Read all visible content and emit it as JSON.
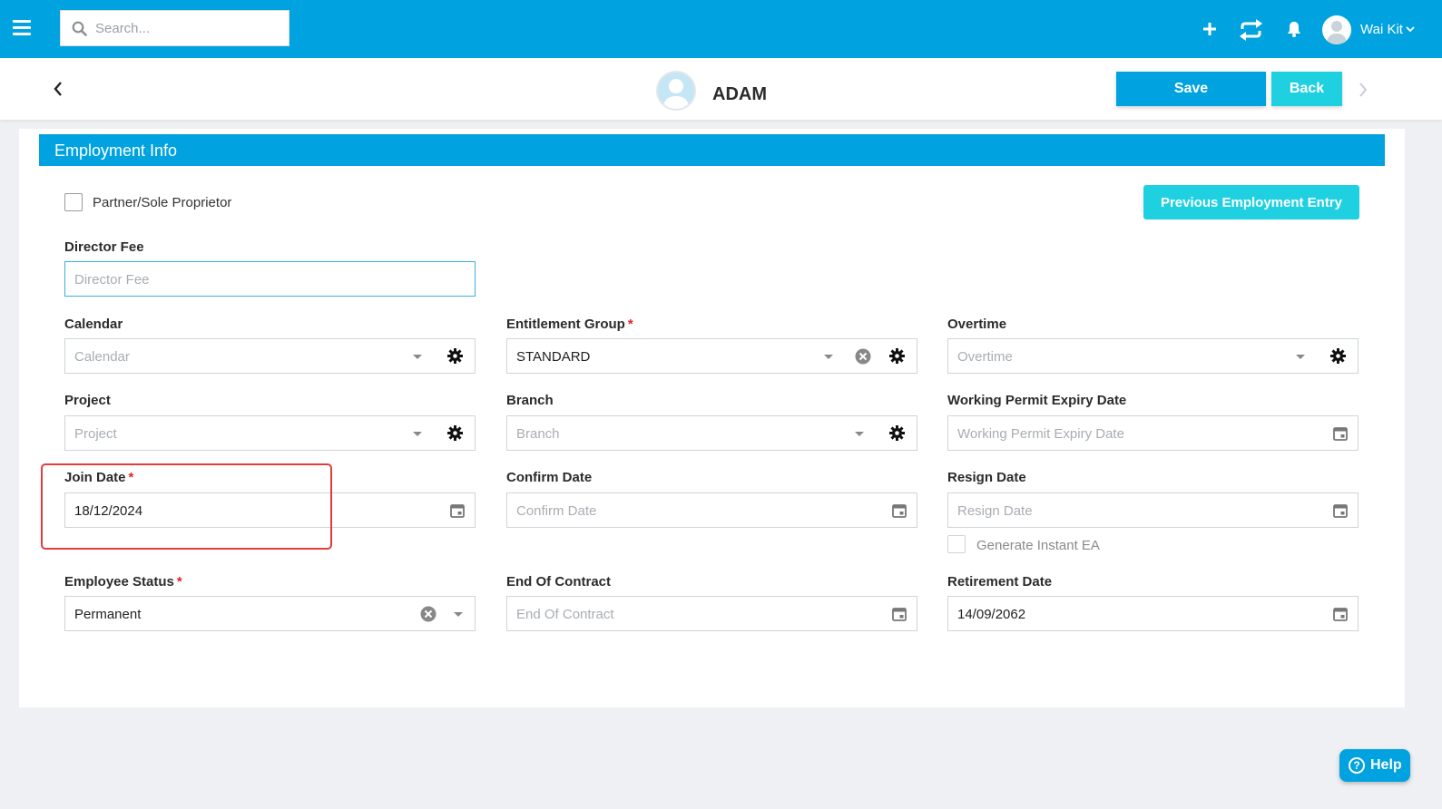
{
  "topbar": {
    "search_placeholder": "Search...",
    "icons": [
      "menu-icon",
      "search-icon",
      "plus-icon",
      "sync-icon",
      "bell-icon",
      "user-avatar",
      "chevron-down-icon"
    ],
    "user_name": "Wai Kit"
  },
  "header": {
    "employee_name": "ADAM",
    "save_label": "Save",
    "back_label": "Back"
  },
  "section": {
    "title": "Employment Info",
    "partner_label": "Partner/Sole Proprietor",
    "previous_employment_label": "Previous Employment Entry"
  },
  "fields": {
    "director_fee": {
      "label": "Director Fee",
      "placeholder": "Director Fee"
    },
    "calendar": {
      "label": "Calendar",
      "placeholder": "Calendar"
    },
    "entitlement_group": {
      "label": "Entitlement Group",
      "required": "*",
      "value": "STANDARD"
    },
    "overtime": {
      "label": "Overtime",
      "placeholder": "Overtime"
    },
    "project": {
      "label": "Project",
      "placeholder": "Project"
    },
    "branch": {
      "label": "Branch",
      "placeholder": "Branch"
    },
    "working_permit_expiry": {
      "label": "Working Permit Expiry Date",
      "placeholder": "Working Permit Expiry Date"
    },
    "join_date": {
      "label": "Join Date",
      "required": "*",
      "value": "18/12/2024"
    },
    "confirm_date": {
      "label": "Confirm Date",
      "placeholder": "Confirm Date"
    },
    "resign_date": {
      "label": "Resign Date",
      "placeholder": "Resign Date"
    },
    "generate_ea_label": "Generate Instant EA",
    "employee_status": {
      "label": "Employee Status",
      "required": "*",
      "value": "Permanent"
    },
    "end_of_contract": {
      "label": "End Of Contract",
      "placeholder": "End Of Contract"
    },
    "retirement_date": {
      "label": "Retirement Date",
      "value": "14/09/2062"
    }
  },
  "help": {
    "label": "Help",
    "glyph": "?"
  },
  "colors": {
    "primary": "#00a3e0",
    "accent": "#1fd1e0",
    "highlight": "#e43b3b"
  }
}
